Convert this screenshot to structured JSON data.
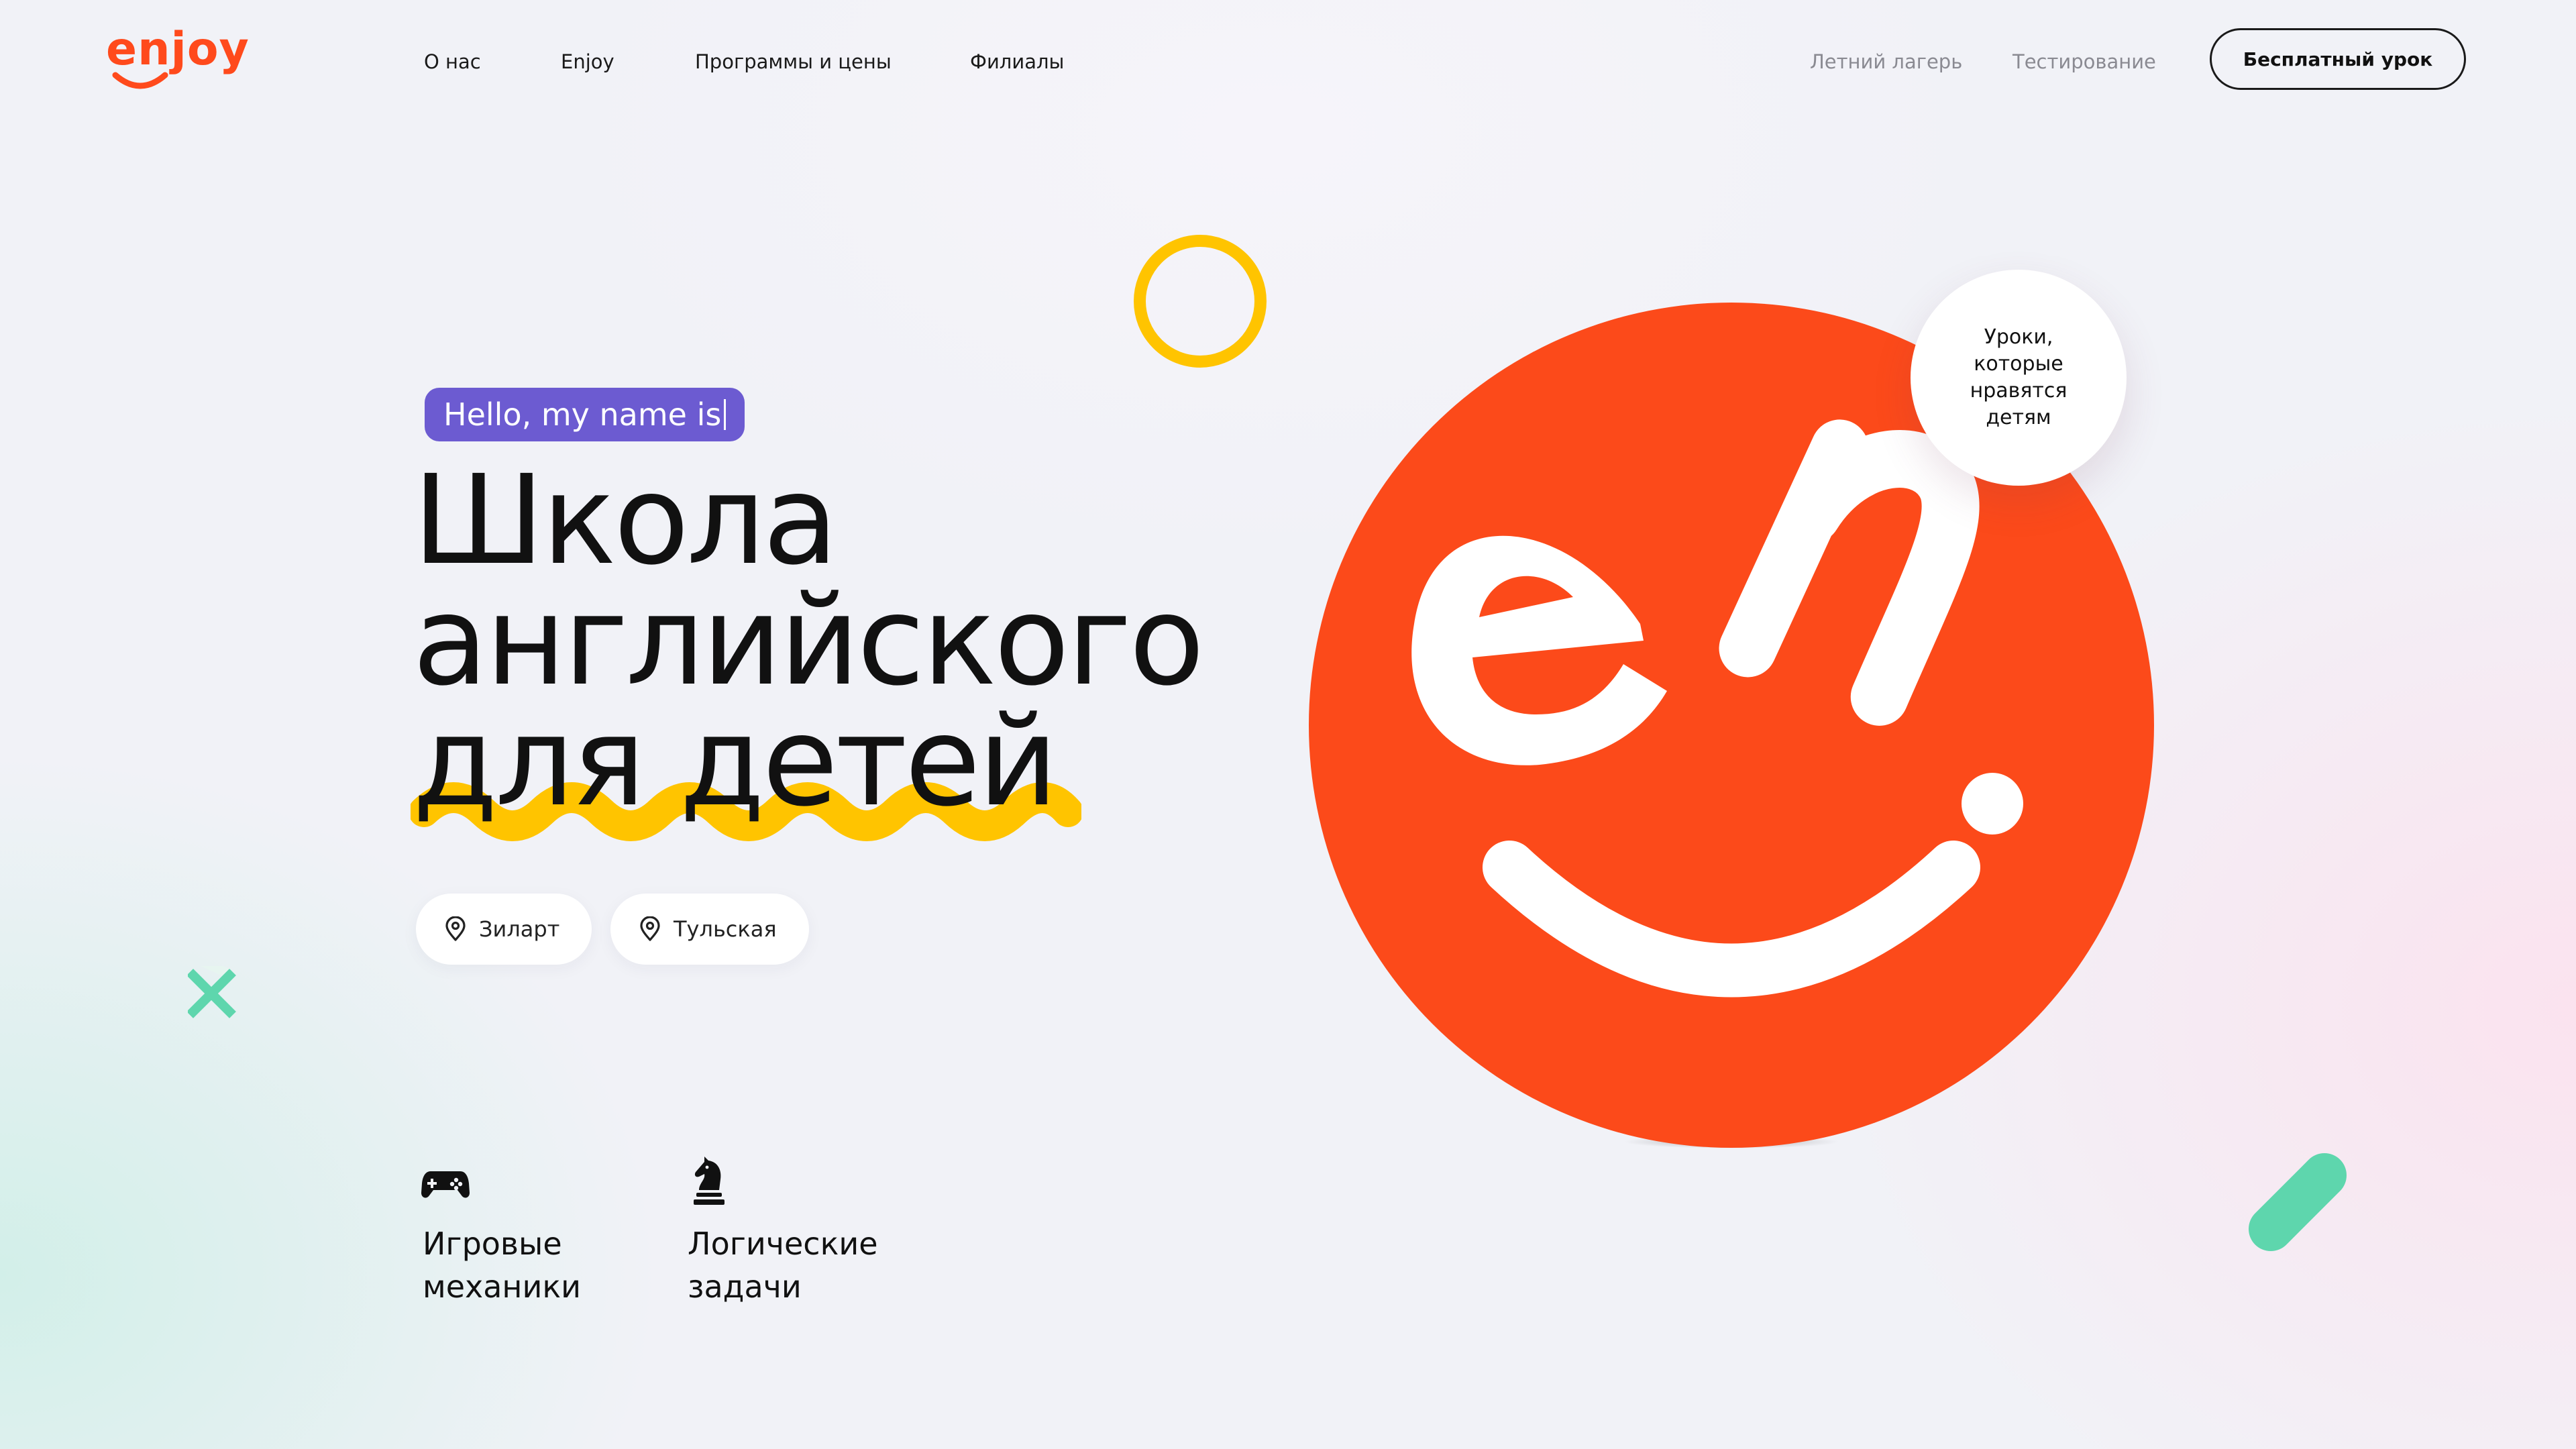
{
  "header": {
    "logo_text": "enjoy",
    "nav_main": [
      {
        "label": "О нас"
      },
      {
        "label": "Enjoy"
      },
      {
        "label": "Программы и цены"
      },
      {
        "label": "Филиалы"
      }
    ],
    "nav_secondary": [
      {
        "label": "Летний лагерь"
      },
      {
        "label": "Тестирование"
      }
    ],
    "cta_label": "Бесплатный урок"
  },
  "hero": {
    "tagline": "Hello, my name is",
    "title_lines": [
      "Школа",
      "английского",
      "для детей"
    ],
    "locations": [
      {
        "label": "Зиларт",
        "icon": "location-pin-icon"
      },
      {
        "label": "Тульская",
        "icon": "location-pin-icon"
      }
    ],
    "features": [
      {
        "icon": "gamepad-icon",
        "line1": "Игровые",
        "line2": "механики"
      },
      {
        "icon": "chess-knight-icon",
        "line1": "Логические",
        "line2": "задачи"
      }
    ],
    "badge_lines": [
      "Уроки,",
      "которые",
      "нравятся",
      "детям"
    ]
  },
  "colors": {
    "brand_orange": "#ff4a1c",
    "tag_purple": "#6c5bd1",
    "accent_yellow": "#ffc400",
    "accent_green": "#5ed6ad",
    "text_dark": "#111111",
    "text_muted": "#8a8a92"
  }
}
